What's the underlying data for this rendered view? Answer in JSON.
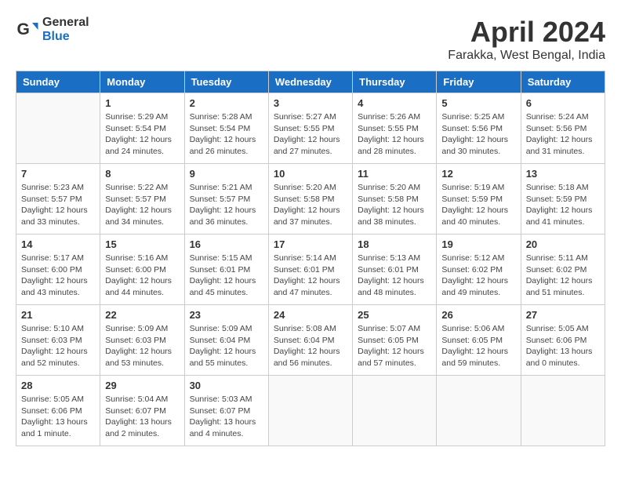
{
  "header": {
    "logo_general": "General",
    "logo_blue": "Blue",
    "month": "April 2024",
    "location": "Farakka, West Bengal, India"
  },
  "weekdays": [
    "Sunday",
    "Monday",
    "Tuesday",
    "Wednesday",
    "Thursday",
    "Friday",
    "Saturday"
  ],
  "weeks": [
    [
      {
        "day": "",
        "info": ""
      },
      {
        "day": "1",
        "info": "Sunrise: 5:29 AM\nSunset: 5:54 PM\nDaylight: 12 hours\nand 24 minutes."
      },
      {
        "day": "2",
        "info": "Sunrise: 5:28 AM\nSunset: 5:54 PM\nDaylight: 12 hours\nand 26 minutes."
      },
      {
        "day": "3",
        "info": "Sunrise: 5:27 AM\nSunset: 5:55 PM\nDaylight: 12 hours\nand 27 minutes."
      },
      {
        "day": "4",
        "info": "Sunrise: 5:26 AM\nSunset: 5:55 PM\nDaylight: 12 hours\nand 28 minutes."
      },
      {
        "day": "5",
        "info": "Sunrise: 5:25 AM\nSunset: 5:56 PM\nDaylight: 12 hours\nand 30 minutes."
      },
      {
        "day": "6",
        "info": "Sunrise: 5:24 AM\nSunset: 5:56 PM\nDaylight: 12 hours\nand 31 minutes."
      }
    ],
    [
      {
        "day": "7",
        "info": "Sunrise: 5:23 AM\nSunset: 5:57 PM\nDaylight: 12 hours\nand 33 minutes."
      },
      {
        "day": "8",
        "info": "Sunrise: 5:22 AM\nSunset: 5:57 PM\nDaylight: 12 hours\nand 34 minutes."
      },
      {
        "day": "9",
        "info": "Sunrise: 5:21 AM\nSunset: 5:57 PM\nDaylight: 12 hours\nand 36 minutes."
      },
      {
        "day": "10",
        "info": "Sunrise: 5:20 AM\nSunset: 5:58 PM\nDaylight: 12 hours\nand 37 minutes."
      },
      {
        "day": "11",
        "info": "Sunrise: 5:20 AM\nSunset: 5:58 PM\nDaylight: 12 hours\nand 38 minutes."
      },
      {
        "day": "12",
        "info": "Sunrise: 5:19 AM\nSunset: 5:59 PM\nDaylight: 12 hours\nand 40 minutes."
      },
      {
        "day": "13",
        "info": "Sunrise: 5:18 AM\nSunset: 5:59 PM\nDaylight: 12 hours\nand 41 minutes."
      }
    ],
    [
      {
        "day": "14",
        "info": "Sunrise: 5:17 AM\nSunset: 6:00 PM\nDaylight: 12 hours\nand 43 minutes."
      },
      {
        "day": "15",
        "info": "Sunrise: 5:16 AM\nSunset: 6:00 PM\nDaylight: 12 hours\nand 44 minutes."
      },
      {
        "day": "16",
        "info": "Sunrise: 5:15 AM\nSunset: 6:01 PM\nDaylight: 12 hours\nand 45 minutes."
      },
      {
        "day": "17",
        "info": "Sunrise: 5:14 AM\nSunset: 6:01 PM\nDaylight: 12 hours\nand 47 minutes."
      },
      {
        "day": "18",
        "info": "Sunrise: 5:13 AM\nSunset: 6:01 PM\nDaylight: 12 hours\nand 48 minutes."
      },
      {
        "day": "19",
        "info": "Sunrise: 5:12 AM\nSunset: 6:02 PM\nDaylight: 12 hours\nand 49 minutes."
      },
      {
        "day": "20",
        "info": "Sunrise: 5:11 AM\nSunset: 6:02 PM\nDaylight: 12 hours\nand 51 minutes."
      }
    ],
    [
      {
        "day": "21",
        "info": "Sunrise: 5:10 AM\nSunset: 6:03 PM\nDaylight: 12 hours\nand 52 minutes."
      },
      {
        "day": "22",
        "info": "Sunrise: 5:09 AM\nSunset: 6:03 PM\nDaylight: 12 hours\nand 53 minutes."
      },
      {
        "day": "23",
        "info": "Sunrise: 5:09 AM\nSunset: 6:04 PM\nDaylight: 12 hours\nand 55 minutes."
      },
      {
        "day": "24",
        "info": "Sunrise: 5:08 AM\nSunset: 6:04 PM\nDaylight: 12 hours\nand 56 minutes."
      },
      {
        "day": "25",
        "info": "Sunrise: 5:07 AM\nSunset: 6:05 PM\nDaylight: 12 hours\nand 57 minutes."
      },
      {
        "day": "26",
        "info": "Sunrise: 5:06 AM\nSunset: 6:05 PM\nDaylight: 12 hours\nand 59 minutes."
      },
      {
        "day": "27",
        "info": "Sunrise: 5:05 AM\nSunset: 6:06 PM\nDaylight: 13 hours\nand 0 minutes."
      }
    ],
    [
      {
        "day": "28",
        "info": "Sunrise: 5:05 AM\nSunset: 6:06 PM\nDaylight: 13 hours\nand 1 minute."
      },
      {
        "day": "29",
        "info": "Sunrise: 5:04 AM\nSunset: 6:07 PM\nDaylight: 13 hours\nand 2 minutes."
      },
      {
        "day": "30",
        "info": "Sunrise: 5:03 AM\nSunset: 6:07 PM\nDaylight: 13 hours\nand 4 minutes."
      },
      {
        "day": "",
        "info": ""
      },
      {
        "day": "",
        "info": ""
      },
      {
        "day": "",
        "info": ""
      },
      {
        "day": "",
        "info": ""
      }
    ]
  ]
}
